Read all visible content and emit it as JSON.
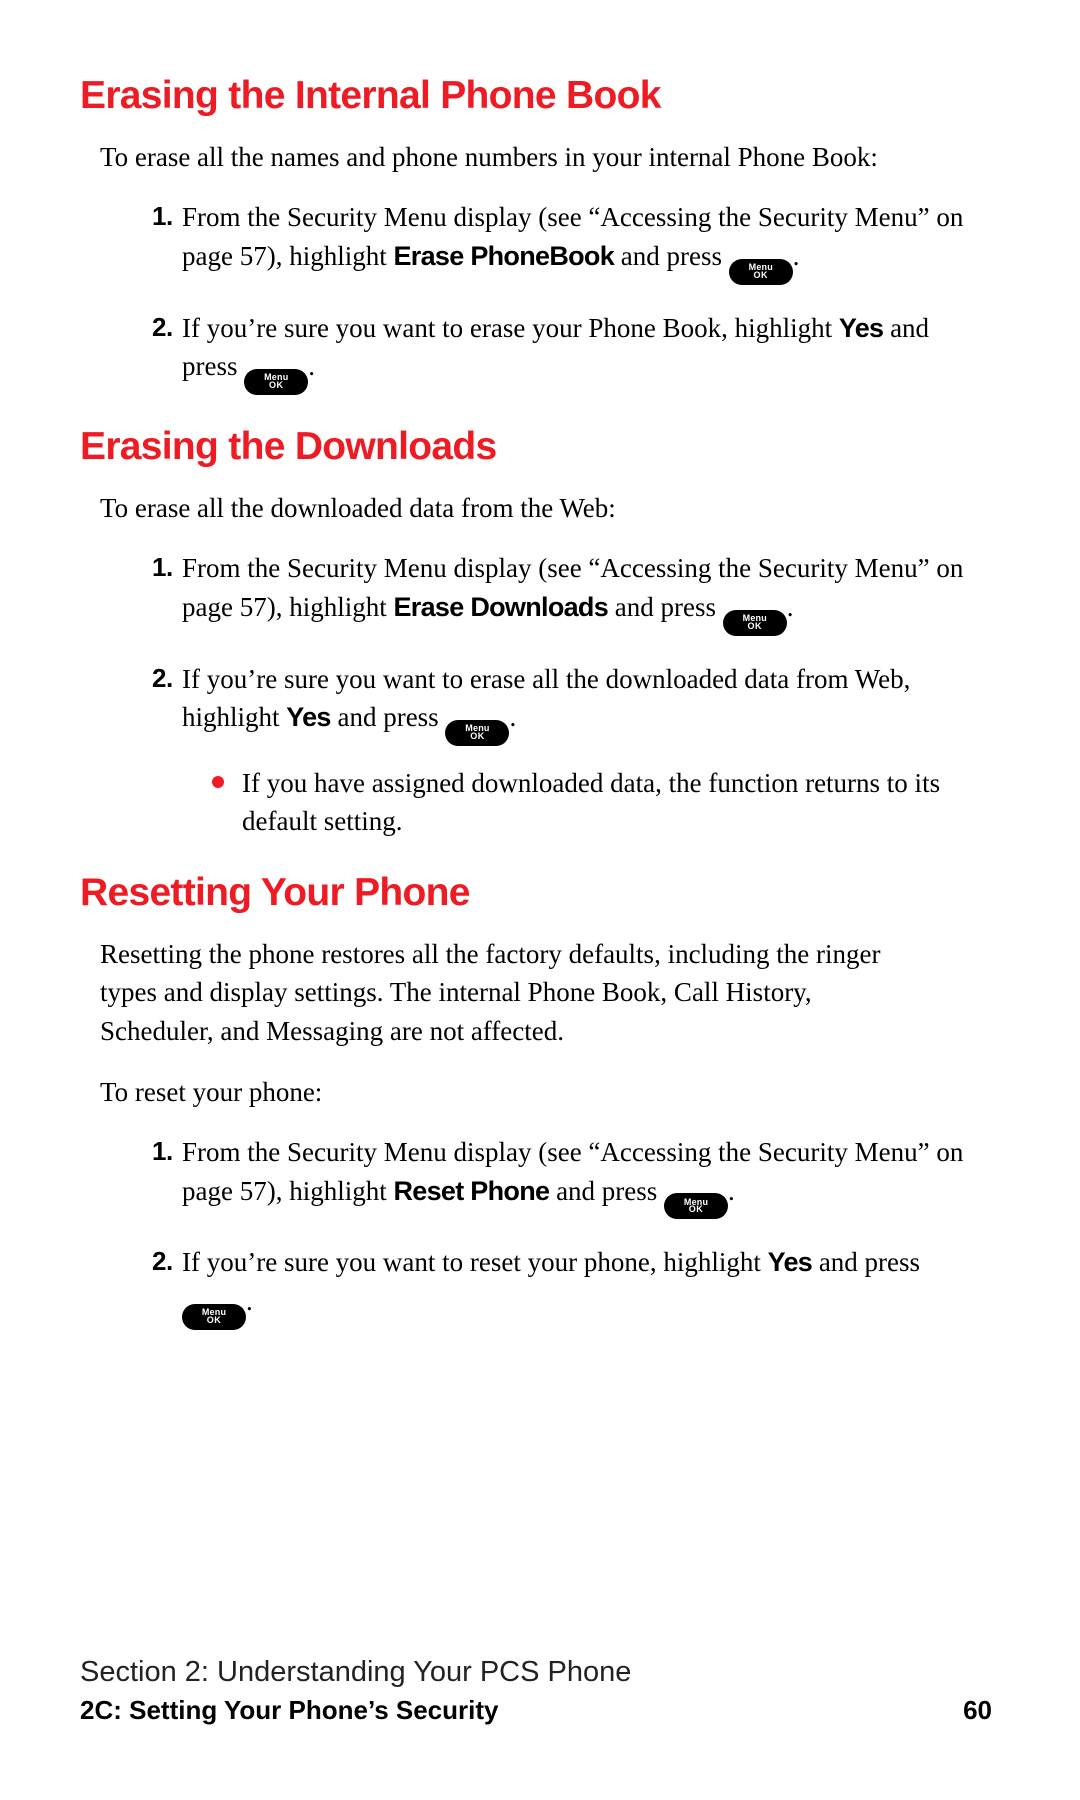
{
  "key": {
    "line1": "Menu",
    "line2": "OK"
  },
  "sections": [
    {
      "heading": "Erasing the Internal Phone Book",
      "intro": "To erase all the names and phone numbers in your internal Phone Book:",
      "steps": [
        {
          "n": "1.",
          "pre": "From the Security Menu display (see “Accessing the Security Menu” on page 57), highlight ",
          "bold": "Erase PhoneBook",
          "mid": " and press ",
          "post": "."
        },
        {
          "n": "2.",
          "pre": "If you’re sure you want to erase your Phone Book, highlight ",
          "bold": "Yes",
          "mid": " and press ",
          "post": "."
        }
      ]
    },
    {
      "heading": "Erasing the Downloads",
      "intro": "To erase all the downloaded data from the Web:",
      "steps": [
        {
          "n": "1.",
          "pre": "From the Security Menu display (see “Accessing the Security Menu” on page 57), highlight ",
          "bold": "Erase Downloads",
          "mid": " and press ",
          "post": "."
        },
        {
          "n": "2.",
          "pre": "If you’re sure you want to erase all the downloaded data from Web, highlight ",
          "bold": "Yes",
          "mid": " and press ",
          "post": ".",
          "bullet": "If you have assigned downloaded data, the function returns to its default setting."
        }
      ]
    },
    {
      "heading": "Resetting Your Phone",
      "intro": "Resetting the phone restores all the factory defaults, including the ringer types and display settings. The internal Phone Book, Call History, Scheduler, and Messaging are not affected.",
      "intro2": "To reset your phone:",
      "steps": [
        {
          "n": "1.",
          "pre": "From the Security Menu display (see “Accessing the Security Menu” on page 57), highlight ",
          "bold": "Reset Phone",
          "mid": " and press ",
          "post": "."
        },
        {
          "n": "2.",
          "pre": "If you’re sure you want to reset your phone, highlight ",
          "bold": "Yes",
          "mid": " and press ",
          "post": "."
        }
      ]
    }
  ],
  "footer": {
    "line1": "Section 2: Understanding Your PCS Phone",
    "line2": "2C: Setting Your Phone’s Security",
    "page": "60"
  }
}
